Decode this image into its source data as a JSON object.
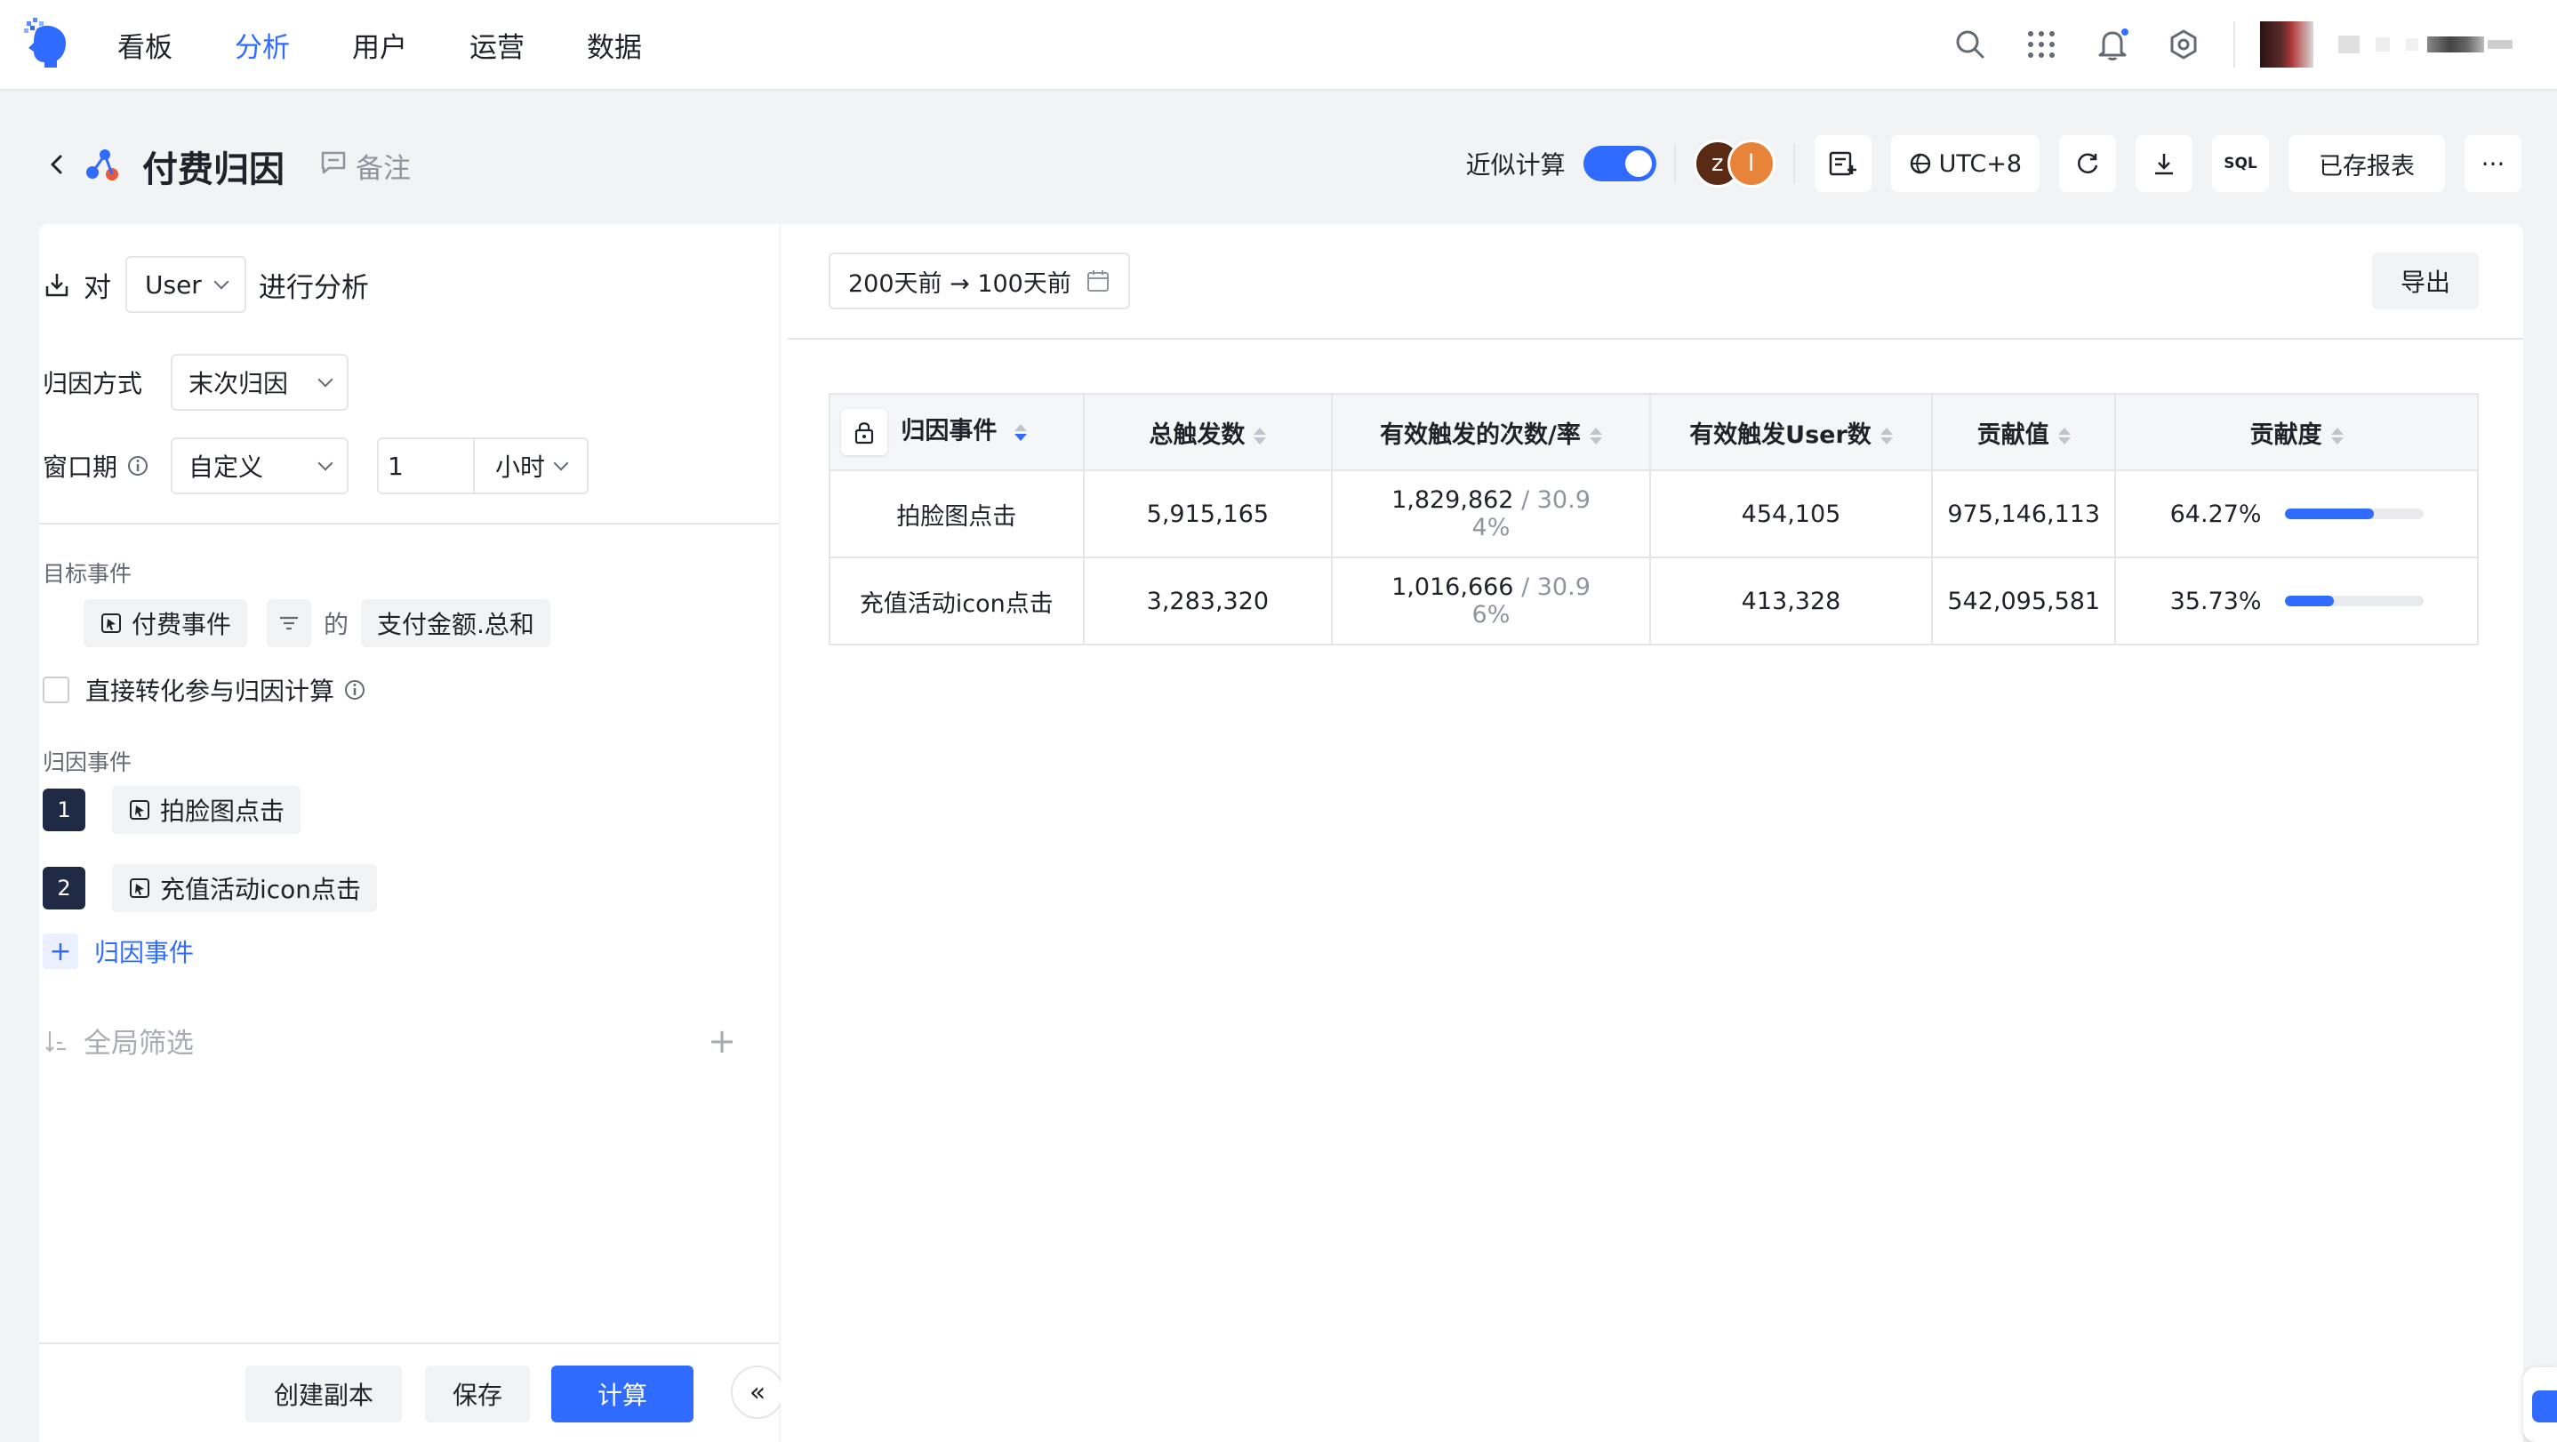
{
  "nav": {
    "items": [
      {
        "label": "看板",
        "active": false
      },
      {
        "label": "分析",
        "active": true
      },
      {
        "label": "用户",
        "active": false
      },
      {
        "label": "运营",
        "active": false
      },
      {
        "label": "数据",
        "active": false
      }
    ]
  },
  "topbar_icons": [
    "search-icon",
    "apps-grid-icon",
    "bell-icon",
    "gear-icon"
  ],
  "page": {
    "title": "付费归因",
    "note_label": "备注"
  },
  "toolbar": {
    "approx_label": "近似计算",
    "approx_enabled": true,
    "avatars": [
      {
        "initial": "z",
        "color": "#5b2a14"
      },
      {
        "initial": "l",
        "color": "#e8833a"
      }
    ],
    "timezone": "UTC+8",
    "sql_label": "SQL",
    "saved_report_label": "已存报表",
    "more_label": "···"
  },
  "left": {
    "analyze_prefix": "对",
    "analyze_entity": "User",
    "analyze_suffix": "进行分析",
    "attribution_method_label": "归因方式",
    "attribution_method_value": "末次归因",
    "window_label": "窗口期",
    "window_type": "自定义",
    "window_number": "1",
    "window_unit": "小时",
    "target_event_section": "目标事件",
    "target_event": "付费事件",
    "target_of": "的",
    "target_metric": "支付金额.总和",
    "direct_conversion_label": "直接转化参与归因计算",
    "direct_conversion_checked": false,
    "attr_event_section": "归因事件",
    "attr_events": [
      {
        "index": "1",
        "label": "拍脸图点击"
      },
      {
        "index": "2",
        "label": "充值活动icon点击"
      }
    ],
    "add_attr_event_label": "归因事件",
    "global_filter_label": "全局筛选",
    "footer": {
      "copy_label": "创建副本",
      "save_label": "保存",
      "compute_label": "计算",
      "collapse_label": "«"
    }
  },
  "right": {
    "date_range": "200天前 → 100天前",
    "export_label": "导出",
    "table": {
      "columns": [
        "归因事件",
        "总触发数",
        "有效触发的次数/率",
        "有效触发User数",
        "贡献值",
        "贡献度"
      ],
      "rows": [
        {
          "event": "拍脸图点击",
          "total": "5,915,165",
          "valid_count": "1,829,862",
          "valid_rate_a": "30.9",
          "valid_rate_b": "4%",
          "valid_users": "454,105",
          "contribution": "975,146,113",
          "share": "64.27%",
          "share_value": 64.27
        },
        {
          "event": "充值活动icon点击",
          "total": "3,283,320",
          "valid_count": "1,016,666",
          "valid_rate_a": "30.9",
          "valid_rate_b": "6%",
          "valid_users": "413,328",
          "contribution": "542,095,581",
          "share": "35.73%",
          "share_value": 35.73
        }
      ]
    }
  },
  "colors": {
    "accent": "#2f6bff",
    "badge_dark": "#1f2a44"
  }
}
